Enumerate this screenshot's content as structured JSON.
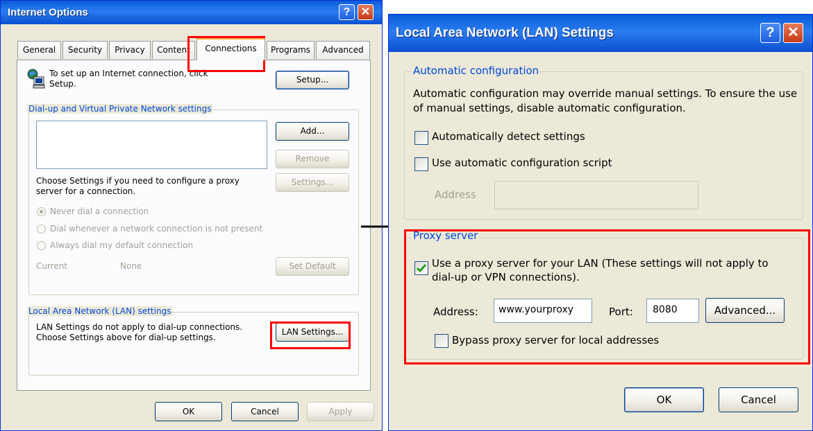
{
  "internet_options": {
    "title": "Internet Options",
    "tabs": [
      "General",
      "Security",
      "Privacy",
      "Content",
      "Connections",
      "Programs",
      "Advanced"
    ],
    "active_tab": "Connections",
    "setup_text": "To set up an Internet connection, click Setup.",
    "setup_button": "Setup...",
    "dialup_legend": "Dial-up and Virtual Private Network settings",
    "add_button": "Add...",
    "remove_button": "Remove",
    "proxy_hint": "Choose Settings if you need to configure a proxy server for a connection.",
    "settings_button": "Settings...",
    "radios": [
      "Never dial a connection",
      "Dial whenever a network connection is not present",
      "Always dial my default connection"
    ],
    "current_label": "Current",
    "current_value": "None",
    "set_default_button": "Set Default",
    "lan_legend": "Local Area Network (LAN) settings",
    "lan_text": "LAN Settings do not apply to dial-up connections. Choose Settings above for dial-up settings.",
    "lan_button": "LAN Settings...",
    "ok_button": "OK",
    "cancel_button": "Cancel",
    "apply_button": "Apply"
  },
  "lan_settings": {
    "title": "Local Area Network (LAN) Settings",
    "auto_legend": "Automatic configuration",
    "auto_desc": "Automatic configuration may override manual settings.  To ensure the use of manual settings, disable automatic configuration.",
    "auto_detect_label": "Automatically detect settings",
    "auto_detect_checked": false,
    "auto_script_label": "Use automatic configuration script",
    "auto_script_checked": false,
    "auto_address_label": "Address",
    "proxy_legend": "Proxy server",
    "use_proxy_label": "Use a proxy server for your LAN (These settings will not apply to dial-up or VPN connections).",
    "use_proxy_checked": true,
    "proxy_address_label": "Address:",
    "proxy_address_value": "www.yourproxy",
    "port_label": "Port:",
    "port_value": "8080",
    "advanced_button": "Advanced...",
    "bypass_label": "Bypass proxy server for local addresses",
    "bypass_checked": false,
    "ok_button": "OK",
    "cancel_button": "Cancel"
  },
  "colors": {
    "highlight": "#ff0000",
    "titlebar": "#0a5bd8",
    "dialog_bg": "#ece9d8",
    "legend_text": "#0046d5"
  }
}
